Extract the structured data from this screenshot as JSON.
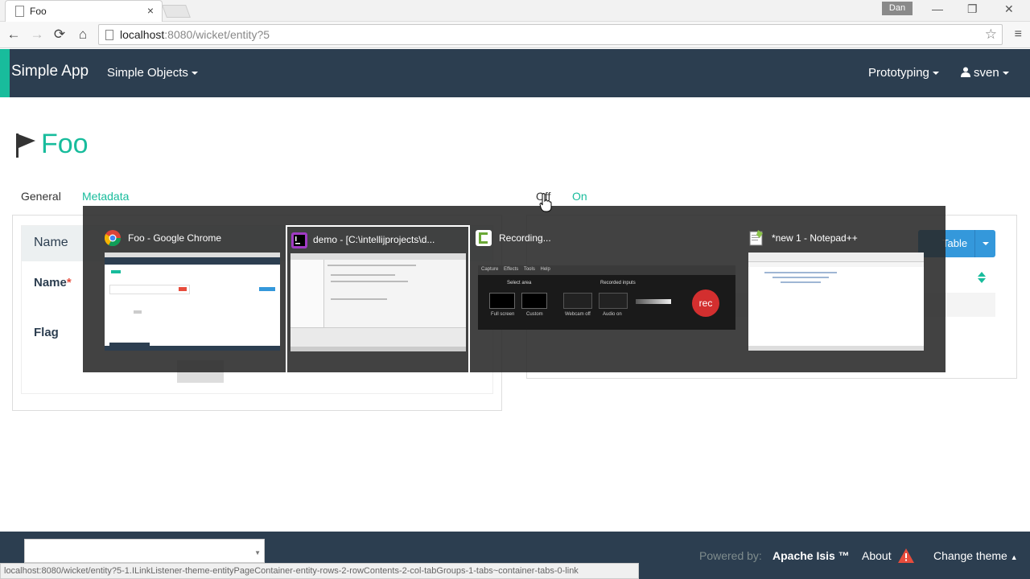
{
  "browser": {
    "tab_title": "Foo",
    "tab_close": "×",
    "user_chip": "Dan",
    "minimize": "—",
    "restore": "❐",
    "close": "✕",
    "url_host": "localhost",
    "url_path": ":8080/wicket/entity?5",
    "back": "←",
    "forward": "→",
    "reload": "⟳",
    "home": "⌂",
    "star": "☆",
    "menu": "≡",
    "status_url": "localhost:8080/wicket/entity?5-1.ILinkListener-theme-entityPageContainer-entity-rows-2-rowContents-2-col-tabGroups-1-tabs~container-tabs-0-link"
  },
  "navbar": {
    "brand": "Simple App",
    "menu_simple_objects": "Simple Objects",
    "menu_prototyping": "Prototyping",
    "menu_user": "sven"
  },
  "page": {
    "title": "Foo",
    "tabs_left": [
      "General",
      "Metadata"
    ],
    "tabs_right": [
      "Off",
      "On"
    ],
    "panel_header": "Name",
    "field_name": "Name",
    "field_name_required": "*",
    "field_flag": "Flag",
    "table_button": "Table"
  },
  "switcher": {
    "windows": [
      {
        "title": "Foo - Google Chrome",
        "icon": "chrome-icon",
        "selected": false
      },
      {
        "title": "demo - [C:\\intellijprojects\\d...",
        "icon": "intellij-icon",
        "selected": true
      },
      {
        "title": "Recording...",
        "icon": "camtasia-icon",
        "selected": false
      },
      {
        "title": "*new 1 - Notepad++",
        "icon": "notepadpp-icon",
        "selected": false
      }
    ],
    "recorder": {
      "menu": [
        "Capture",
        "Effects",
        "Tools",
        "Help"
      ],
      "select_area": "Select area",
      "recorded_inputs": "Recorded inputs",
      "full_screen": "Full screen",
      "custom": "Custom",
      "webcam_off": "Webcam off",
      "audio_on": "Audio on",
      "rec": "rec"
    }
  },
  "footer": {
    "powered_by": "Powered by:",
    "apache_isis": "Apache Isis ™",
    "about": "About",
    "change_theme": "Change theme"
  },
  "colors": {
    "navbar": "#2c3e50",
    "accent": "#18bc9c",
    "primary": "#3498db",
    "danger": "#e74c3c"
  }
}
